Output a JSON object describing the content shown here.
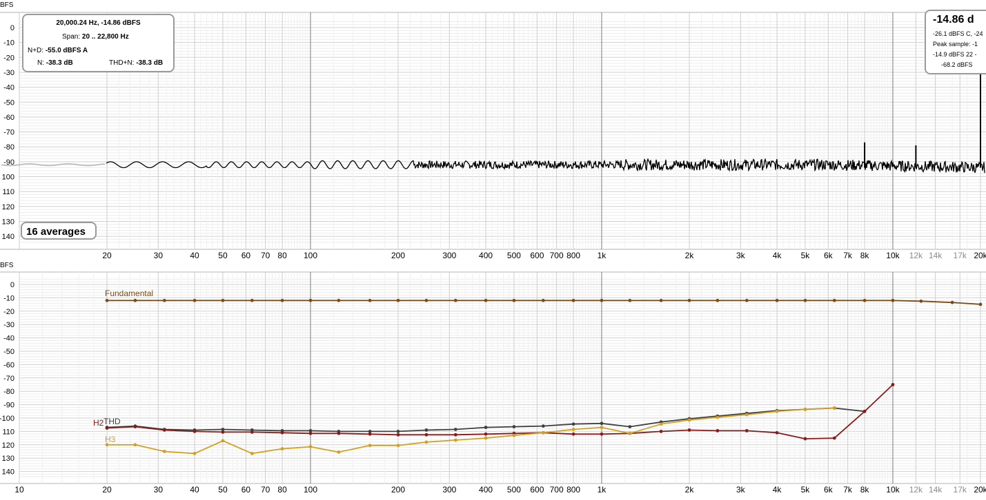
{
  "chart_data": [
    {
      "type": "line",
      "ylabel_partial": "BFS",
      "xscale": "log",
      "xlim": [
        20,
        22000
      ],
      "ylim": [
        -145,
        5
      ],
      "yticks": [
        0,
        -10,
        -20,
        -30,
        -40,
        -50,
        -60,
        -70,
        -80,
        -90,
        -100,
        -110,
        -120,
        -130,
        -140
      ],
      "ytick_labels": [
        "0",
        "-10",
        "-20",
        "-30",
        "-40",
        "-50",
        "-60",
        "-70",
        "-80",
        "-90",
        "100",
        "110",
        "120",
        "130",
        "140"
      ],
      "xticks": [
        20,
        30,
        40,
        50,
        60,
        70,
        80,
        100,
        200,
        300,
        400,
        500,
        600,
        700,
        800,
        1000,
        2000,
        3000,
        4000,
        5000,
        6000,
        7000,
        8000,
        10000,
        12000,
        14000,
        17000,
        20000
      ],
      "xtick_labels": [
        "20",
        "30",
        "40",
        "50",
        "60",
        "70",
        "80",
        "100",
        "200",
        "300",
        "400",
        "500",
        "600",
        "700",
        "800",
        "1k",
        "2k",
        "3k",
        "4k",
        "5k",
        "6k",
        "7k",
        "8k",
        "10k",
        "12k",
        "14k",
        "17k",
        "20k"
      ],
      "grid": true,
      "series": [
        {
          "color": "#000000",
          "noise_floor_dbfs": -92,
          "spikes": [
            {
              "x": 8000,
              "y": -77
            },
            {
              "x": 12000,
              "y": -79
            },
            {
              "x": 20000,
              "y": -14.86
            }
          ]
        }
      ]
    },
    {
      "type": "line",
      "ylabel_partial": "BFS",
      "xscale": "log",
      "xlim": [
        10,
        22000
      ],
      "ylim": [
        -145,
        5
      ],
      "yticks": [
        0,
        -10,
        -20,
        -30,
        -40,
        -50,
        -60,
        -70,
        -80,
        -90,
        -100,
        -110,
        -120,
        -130,
        -140
      ],
      "ytick_labels": [
        "0",
        "-10",
        "-20",
        "-30",
        "-40",
        "-50",
        "-60",
        "-70",
        "-80",
        "-90",
        "-100",
        "110",
        "120",
        "130",
        "140"
      ],
      "xticks": [
        10,
        20,
        30,
        40,
        50,
        60,
        70,
        80,
        100,
        200,
        300,
        400,
        500,
        600,
        700,
        800,
        1000,
        2000,
        3000,
        4000,
        5000,
        6000,
        7000,
        8000,
        10000,
        12000,
        14000,
        17000,
        20000
      ],
      "xtick_labels": [
        "10",
        "20",
        "30",
        "40",
        "50",
        "60",
        "70",
        "80",
        "100",
        "200",
        "300",
        "400",
        "500",
        "600",
        "700",
        "800",
        "1k",
        "2k",
        "3k",
        "4k",
        "5k",
        "6k",
        "7k",
        "8k",
        "10k",
        "12k",
        "14k",
        "17k",
        "20k"
      ],
      "grid": true,
      "x": [
        20,
        25,
        31.5,
        40,
        50,
        63,
        80,
        100,
        125,
        160,
        200,
        250,
        315,
        400,
        500,
        630,
        800,
        1000,
        1250,
        1600,
        2000,
        2500,
        3150,
        4000,
        5000,
        6300,
        8000,
        10000,
        12500,
        16000,
        20000
      ],
      "series": [
        {
          "name": "Fundamental",
          "color": "#7a4a18",
          "values": [
            -12,
            -12,
            -12,
            -12,
            -12,
            -12,
            -12,
            -12,
            -12,
            -12,
            -12,
            -12,
            -12,
            -12,
            -12,
            -12,
            -12,
            -12,
            -12,
            -12,
            -12,
            -12,
            -12,
            -12,
            -12,
            -12,
            -12,
            -12,
            -12.5,
            -13.5,
            -14.9
          ]
        },
        {
          "name": "THD",
          "color": "#404040",
          "values": [
            -107,
            -106,
            -108.5,
            -109,
            -108.5,
            -109,
            -109.5,
            -109.5,
            -110,
            -110,
            -110,
            -109,
            -108.5,
            -107,
            -106.5,
            -106,
            -104.5,
            -104,
            -106.5,
            -103,
            -100.5,
            -98.5,
            -96.5,
            -94.5,
            -93.5,
            -92.5,
            -95
          ]
        },
        {
          "name": "H2",
          "color": "#8b1a1a",
          "values": [
            -107.5,
            -106.5,
            -109,
            -110,
            -110.5,
            -110.5,
            -111,
            -111.5,
            -111.5,
            -112,
            -112.5,
            -112.5,
            -112.5,
            -112,
            -111.5,
            -111,
            -112,
            -112,
            -111.5,
            -110,
            -109,
            -109.5,
            -109.5,
            -111,
            -115.5,
            -115,
            -95,
            -75
          ]
        },
        {
          "name": "H3",
          "color": "#d4a020",
          "values": [
            -120,
            -120,
            -125,
            -126.5,
            -117,
            -126.5,
            -123,
            -121.5,
            -125.5,
            -120.5,
            -120.5,
            -118,
            -116.5,
            -115,
            -113,
            -111,
            -108.5,
            -107,
            -111.5,
            -104.5,
            -101.5,
            -99.5,
            -97.5,
            -95,
            -93.5,
            -92.5
          ]
        }
      ]
    }
  ],
  "measurement": {
    "freq_level": "20,000.24 Hz, -14.86 dBFS",
    "span_label": "Span:",
    "span_value": "20 .. 22,800 Hz",
    "nd_label": "N+D:",
    "nd_value": "-55.0 dBFS A",
    "n_label": "N:",
    "n_value": "-38.3 dB",
    "thdn_label": "THD+N:",
    "thdn_value": "-38.3 dB"
  },
  "peak": {
    "big": "-14.86 d",
    "l1": "-26.1 dBFS C, -24",
    "l2": "Peak sample: -1",
    "l3": "-14.9 dBFS 22 -",
    "l4": "-68.2 dBFS"
  },
  "averages_label": "16 averages"
}
